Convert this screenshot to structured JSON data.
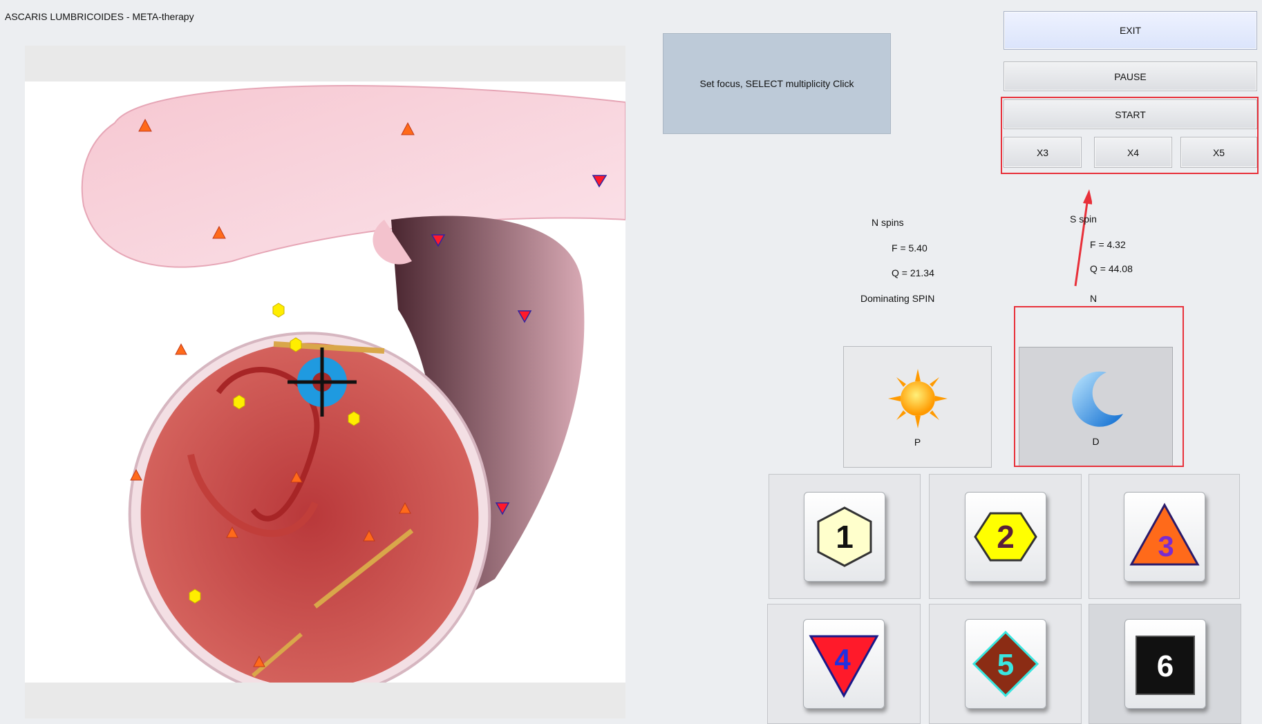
{
  "window": {
    "title": "ASCARIS  LUMBRICOIDES - META-therapy"
  },
  "info_box": {
    "text": "Set focus, SELECT multiplicity Click"
  },
  "controls": {
    "exit_label": "EXIT",
    "pause_label": "PAUSE",
    "start_label": "START",
    "multiplicity": [
      "X3",
      "X4",
      "X5"
    ]
  },
  "n_spins": {
    "title": "N spins",
    "f": "F =  5.40",
    "q": "Q = 21.34"
  },
  "s_spin": {
    "title": "S spin",
    "f": "F =  4.32",
    "q": "Q = 44.08"
  },
  "dominating": {
    "label": "Dominating SPIN",
    "value": "N"
  },
  "spin_buttons": {
    "p_label": "P",
    "d_label": "D",
    "p_icon": "sun-icon",
    "d_icon": "moon-icon"
  },
  "markers": [
    {
      "number": "1",
      "shape": "hexagon",
      "fill": "#ffffcc",
      "text_color": "#111111"
    },
    {
      "number": "2",
      "shape": "hexagon",
      "fill": "#ffff00",
      "text_color": "#5a1f3a"
    },
    {
      "number": "3",
      "shape": "triangle-up",
      "fill": "#ff6a1a",
      "text_color": "#7a2cd0"
    },
    {
      "number": "4",
      "shape": "triangle-down",
      "fill": "#ff1a2a",
      "text_color": "#2030e0"
    },
    {
      "number": "5",
      "shape": "diamond",
      "fill": "#8b2c14",
      "text_color": "#39e6e0"
    },
    {
      "number": "6",
      "shape": "square",
      "fill": "#111111",
      "text_color": "#ffffff"
    }
  ],
  "colors": {
    "highlight": "#e8303a",
    "info_box": "#bdcad8",
    "exit_button": "#dbe4fb"
  }
}
